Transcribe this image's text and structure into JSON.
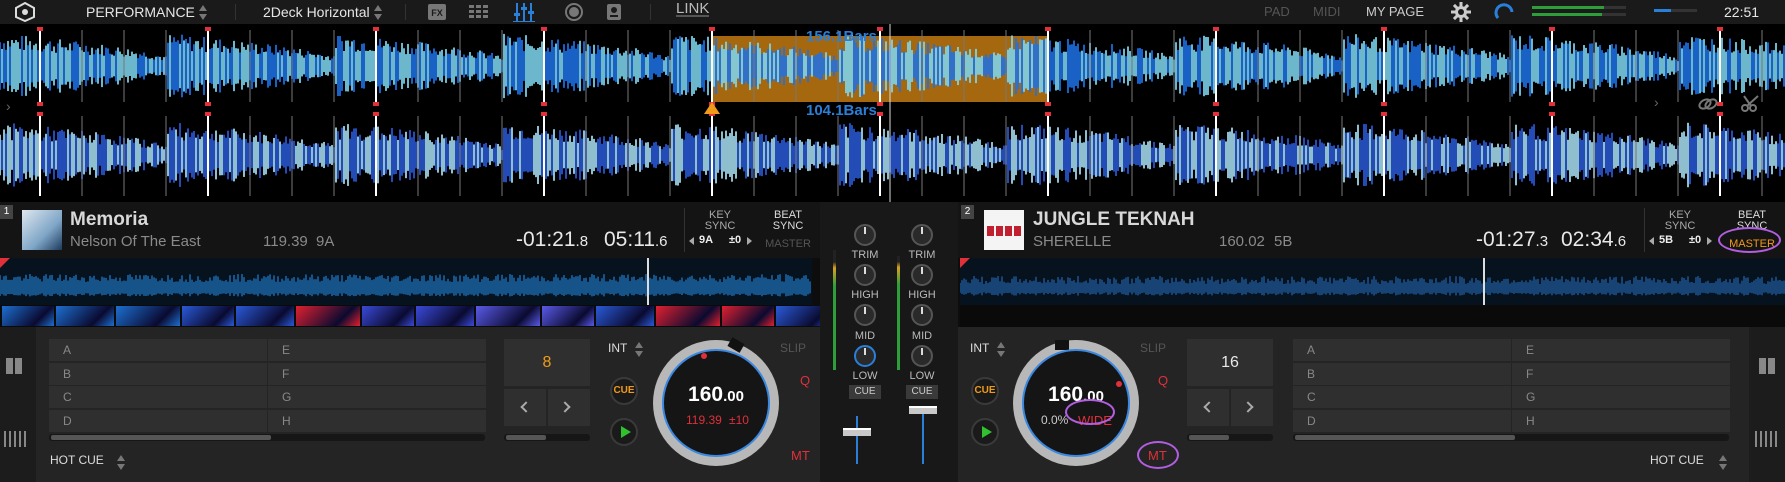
{
  "topbar": {
    "mode": "PERFORMANCE",
    "layout": "2Deck Horizontal",
    "link": "LINK",
    "pad": "PAD",
    "midi": "MIDI",
    "mypage": "MY PAGE",
    "clock": "22:51",
    "icons": [
      "rekordbox-logo-icon",
      "fx-icon",
      "sampler-grid-icon",
      "mixer-icon",
      "record-icon",
      "mic-icon",
      "gear-icon"
    ]
  },
  "waves": {
    "top_bars": "156.1Bars",
    "bottom_bars": "104.1Bars"
  },
  "deck1": {
    "number": "1",
    "title": "Memoria",
    "artist": "Nelson Of The East",
    "bpm": "119.39",
    "key": "9A",
    "remain_main": "-01:21",
    "remain_frac": ".8",
    "total_main": "05:11",
    "total_frac": ".6",
    "key_sync_label": "KEY\nSYNC",
    "key_value": "9A",
    "key_offset": "±0",
    "beat_sync_label": "BEAT\nSYNC",
    "master_label": "MASTER",
    "pads": [
      "A",
      "B",
      "C",
      "D",
      "E",
      "F",
      "G",
      "H"
    ],
    "mode_label": "HOT CUE",
    "beat_jump": "8",
    "int_label": "INT",
    "slip_label": "SLIP",
    "cue_label": "CUE",
    "q_label": "Q",
    "mt_label": "MT",
    "jog_bpm": "160",
    "jog_bpm_frac": ".00",
    "jog_orig": "119.39",
    "jog_range": "±10"
  },
  "deck2": {
    "number": "2",
    "title": "JUNGLE TEKNAH",
    "artist": "SHERELLE",
    "bpm": "160.02",
    "key": "5B",
    "remain_main": "-01:27",
    "remain_frac": ".3",
    "total_main": "02:34",
    "total_frac": ".6",
    "key_sync_label": "KEY\nSYNC",
    "key_value": "5B",
    "key_offset": "±0",
    "beat_sync_label": "BEAT\nSYNC",
    "master_label": "MASTER",
    "pads": [
      "A",
      "B",
      "C",
      "D",
      "E",
      "F",
      "G",
      "H"
    ],
    "mode_label": "HOT CUE",
    "beat_jump": "16",
    "int_label": "INT",
    "slip_label": "SLIP",
    "cue_label": "CUE",
    "q_label": "Q",
    "mt_label": "MT",
    "jog_bpm": "160",
    "jog_bpm_frac": ".00",
    "jog_pitch": "0.0%",
    "jog_range": "WIDE"
  },
  "mixer": {
    "trim": "TRIM",
    "high": "HIGH",
    "mid": "MID",
    "low": "LOW",
    "cue": "CUE"
  },
  "colors": {
    "accent_blue": "#2a7fd8",
    "master_orange": "#f09a1a",
    "loop_orange": "#c27a10",
    "red": "#e0303a",
    "annotation_purple": "#b25ee0"
  }
}
